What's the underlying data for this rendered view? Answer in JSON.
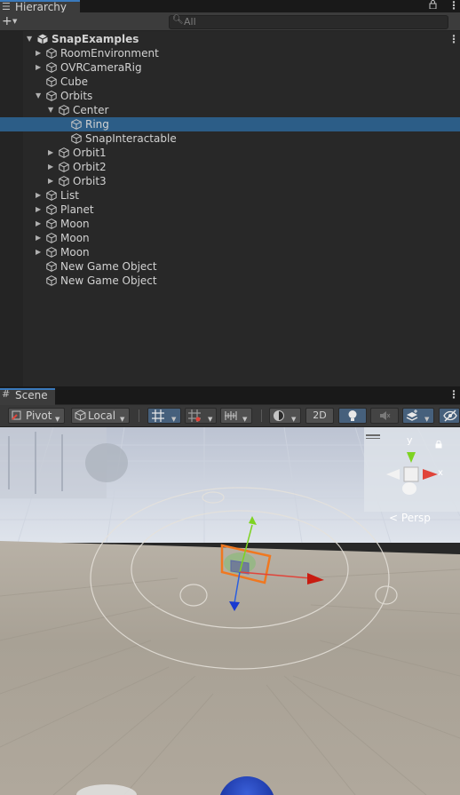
{
  "hierarchy": {
    "tab_label": "Hierarchy",
    "tab_icon": "hierarchy-list-icon",
    "add_label": "+",
    "search": {
      "placeholder": "All",
      "value": ""
    },
    "items": [
      {
        "label": "SnapExamples",
        "depth": 0,
        "expander": "expanded",
        "is_scene": true
      },
      {
        "label": "RoomEnvironment",
        "depth": 1,
        "expander": "collapsed"
      },
      {
        "label": "OVRCameraRig",
        "depth": 1,
        "expander": "collapsed"
      },
      {
        "label": "Cube",
        "depth": 1,
        "expander": "none"
      },
      {
        "label": "Orbits",
        "depth": 1,
        "expander": "expanded"
      },
      {
        "label": "Center",
        "depth": 2,
        "expander": "expanded"
      },
      {
        "label": "Ring",
        "depth": 3,
        "expander": "none",
        "selected": true
      },
      {
        "label": "SnapInteractable",
        "depth": 3,
        "expander": "none"
      },
      {
        "label": "Orbit1",
        "depth": 2,
        "expander": "collapsed"
      },
      {
        "label": "Orbit2",
        "depth": 2,
        "expander": "collapsed"
      },
      {
        "label": "Orbit3",
        "depth": 2,
        "expander": "collapsed"
      },
      {
        "label": "List",
        "depth": 1,
        "expander": "collapsed"
      },
      {
        "label": "Planet",
        "depth": 1,
        "expander": "collapsed"
      },
      {
        "label": "Moon",
        "depth": 1,
        "expander": "collapsed"
      },
      {
        "label": "Moon",
        "depth": 1,
        "expander": "collapsed"
      },
      {
        "label": "Moon",
        "depth": 1,
        "expander": "collapsed"
      },
      {
        "label": "New Game Object",
        "depth": 1,
        "expander": "none"
      },
      {
        "label": "New Game Object",
        "depth": 1,
        "expander": "none"
      }
    ]
  },
  "scene": {
    "tab_label": "Scene",
    "toolbar": {
      "pivot_label": "Pivot",
      "local_label": "Local",
      "mode_2d_label": "2D"
    },
    "gizmo": {
      "y_label": "y",
      "x_label": "x",
      "persp_label": "Persp"
    }
  },
  "colors": {
    "accent": "#3a79bb",
    "selection": "#2c5d87",
    "axis_x": "#e0443a",
    "axis_y": "#7ed321",
    "axis_z": "#2a5fe0",
    "selection_outline": "#f07820"
  }
}
